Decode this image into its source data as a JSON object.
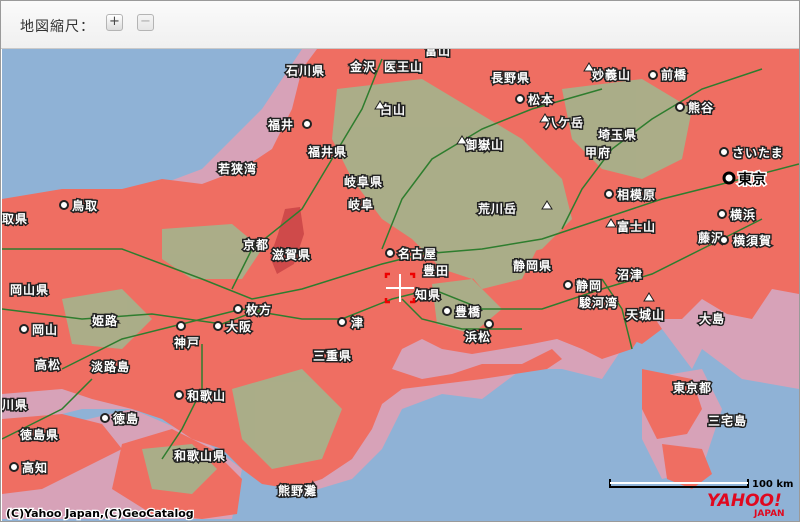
{
  "toolbar": {
    "scale_label": "地図縮尺：",
    "zoom_in_symbol": "+",
    "zoom_out_symbol": "−"
  },
  "map": {
    "colors": {
      "sea": "#8fb2d6",
      "coverage": "#ef6e62",
      "fringe": "#d7a2b8",
      "forest": "#9fb98f",
      "road": "#2e7d2e"
    },
    "places": [
      {
        "name": "石川県"
      },
      {
        "name": "金沢"
      },
      {
        "name": "医王山"
      },
      {
        "name": "富山"
      },
      {
        "name": "長野県"
      },
      {
        "name": "妙義山"
      },
      {
        "name": "前橋"
      },
      {
        "name": "白山"
      },
      {
        "name": "松本"
      },
      {
        "name": "熊谷"
      },
      {
        "name": "福井"
      },
      {
        "name": "八ケ岳"
      },
      {
        "name": "埼玉県"
      },
      {
        "name": "福井県"
      },
      {
        "name": "御嶽山"
      },
      {
        "name": "甲府"
      },
      {
        "name": "さいたま"
      },
      {
        "name": "若狭湾"
      },
      {
        "name": "岐阜県"
      },
      {
        "name": "東京"
      },
      {
        "name": "相模原"
      },
      {
        "name": "鳥取"
      },
      {
        "name": "岐阜"
      },
      {
        "name": "荒川岳"
      },
      {
        "name": "横浜"
      },
      {
        "name": "取県"
      },
      {
        "name": "富士山"
      },
      {
        "name": "京都"
      },
      {
        "name": "滋賀県"
      },
      {
        "name": "名古屋"
      },
      {
        "name": "藤沢"
      },
      {
        "name": "横須賀"
      },
      {
        "name": "豊田"
      },
      {
        "name": "静岡県"
      },
      {
        "name": "岡山県"
      },
      {
        "name": "枚方"
      },
      {
        "name": "知県"
      },
      {
        "name": "静岡"
      },
      {
        "name": "沼津"
      },
      {
        "name": "姫路"
      },
      {
        "name": "豊橋"
      },
      {
        "name": "駿河湾"
      },
      {
        "name": "天城山"
      },
      {
        "name": "大島"
      },
      {
        "name": "岡山"
      },
      {
        "name": "大阪"
      },
      {
        "name": "津"
      },
      {
        "name": "神戸"
      },
      {
        "name": "浜松"
      },
      {
        "name": "高松"
      },
      {
        "name": "淡路島"
      },
      {
        "name": "三重県"
      },
      {
        "name": "川県"
      },
      {
        "name": "和歌山"
      },
      {
        "name": "東京都"
      },
      {
        "name": "徳島"
      },
      {
        "name": "三宅島"
      },
      {
        "name": "徳島県"
      },
      {
        "name": "和歌山県"
      },
      {
        "name": "高知"
      },
      {
        "name": "熊野灘"
      }
    ],
    "scale_bar": "100 km",
    "copyright": "(C)Yahoo Japan,(C)GeoCatalog",
    "logo_main": "YAHOO!",
    "logo_sub": "JAPAN"
  }
}
